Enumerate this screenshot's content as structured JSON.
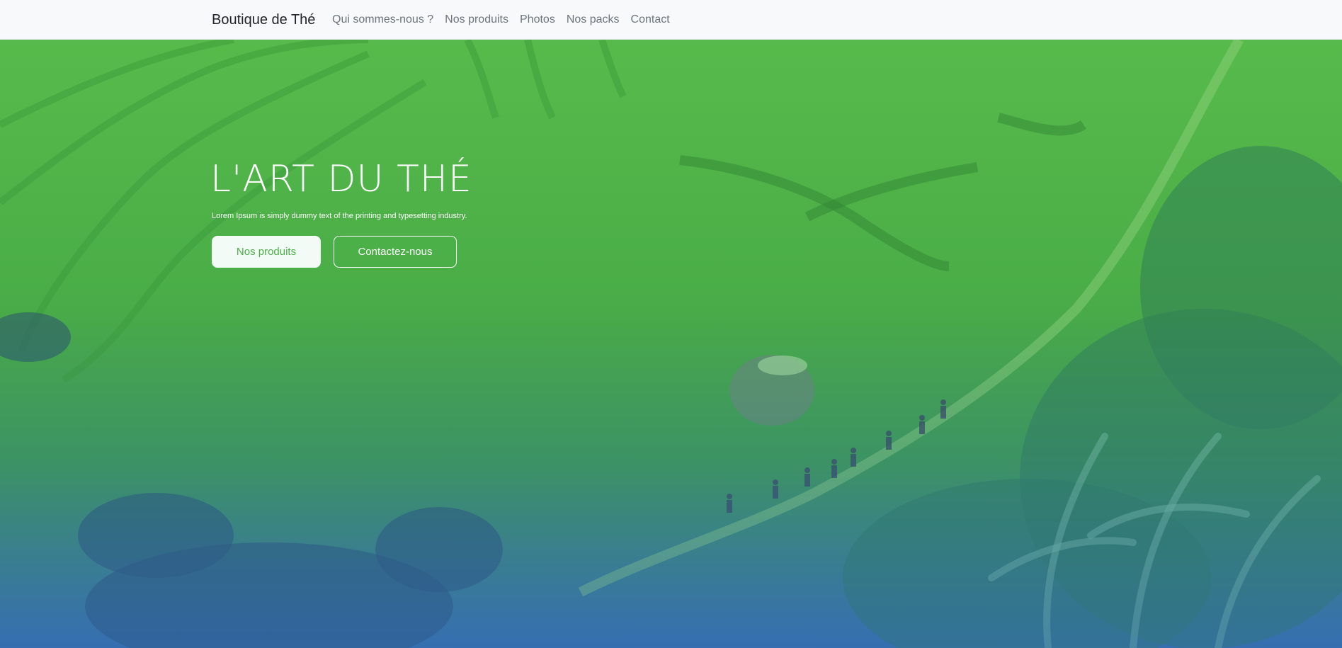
{
  "navbar": {
    "brand": "Boutique de Thé",
    "links": [
      "Qui sommes-nous ?",
      "Nos produits",
      "Photos",
      "Nos packs",
      "Contact"
    ]
  },
  "hero": {
    "title": "L'ART DU THÉ",
    "subtitle": "Lorem Ipsum is simply dummy text of the printing and typesetting industry.",
    "primary_button": "Nos produits",
    "secondary_button": "Contactez-nous",
    "background_image": "rice-terrace-landscape"
  },
  "colors": {
    "navbar_bg": "#f8f9fa",
    "accent_green": "#4cae46",
    "hero_gradient_top": "#57b94c",
    "hero_gradient_bottom": "#3a6fa6"
  }
}
